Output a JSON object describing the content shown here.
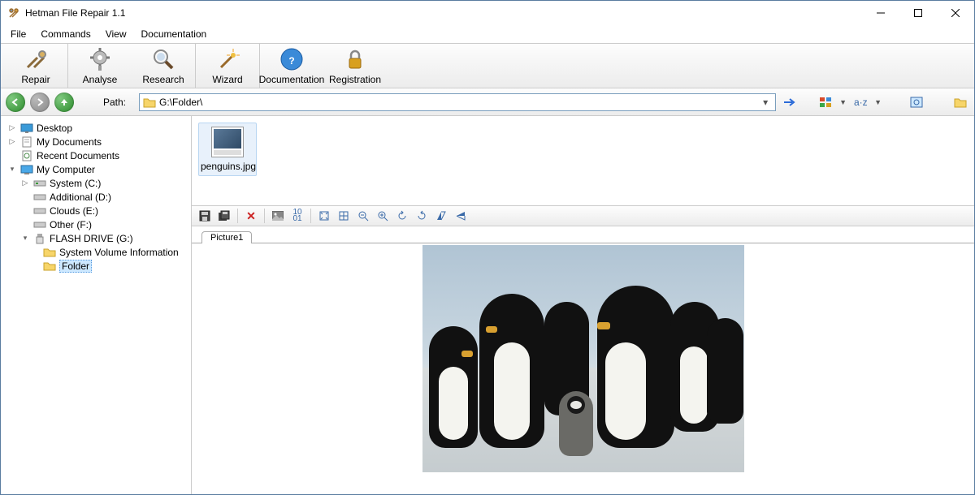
{
  "window": {
    "title": "Hetman File Repair 1.1"
  },
  "menu": {
    "file": "File",
    "commands": "Commands",
    "view": "View",
    "documentation": "Documentation"
  },
  "toolbar": {
    "repair": "Repair",
    "analyse": "Analyse",
    "research": "Research",
    "wizard": "Wizard",
    "documentation": "Documentation",
    "registration": "Registration"
  },
  "nav": {
    "path_label": "Path:",
    "path_value": "G:\\Folder\\"
  },
  "tree": {
    "desktop": "Desktop",
    "my_documents": "My Documents",
    "recent_documents": "Recent Documents",
    "my_computer": "My Computer",
    "system_c": "System (C:)",
    "additional_d": "Additional (D:)",
    "clouds_e": "Clouds (E:)",
    "other_f": "Other (F:)",
    "flash_drive_g": "FLASH DRIVE (G:)",
    "sys_vol_info": "System Volume Information",
    "folder": "Folder"
  },
  "files": {
    "penguins": "penguins.jpg"
  },
  "preview": {
    "tab1": "Picture1"
  }
}
